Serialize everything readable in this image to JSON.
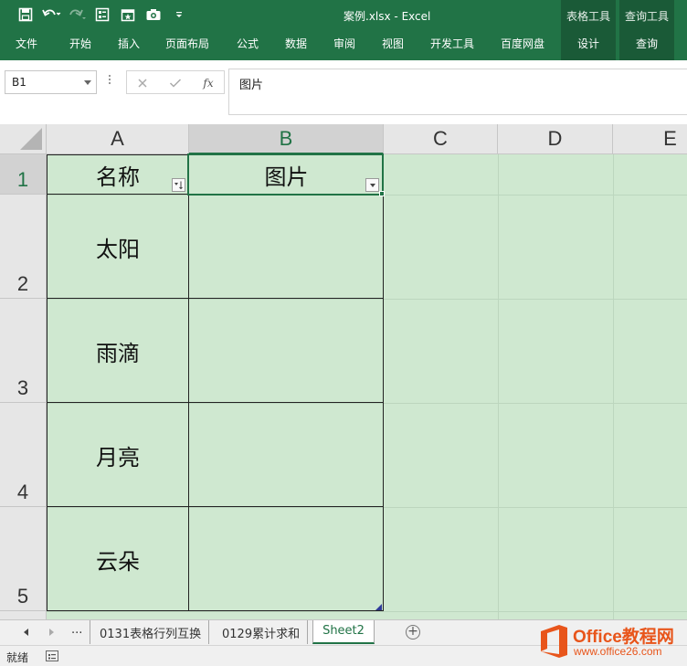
{
  "window": {
    "title": "案例.xlsx - Excel",
    "accent": "#217346"
  },
  "quick_access": [
    {
      "icon": "save-icon"
    },
    {
      "icon": "undo-icon"
    },
    {
      "icon": "redo-icon"
    },
    {
      "icon": "form-icon"
    },
    {
      "icon": "new-sheet-icon"
    },
    {
      "icon": "camera-icon"
    },
    {
      "icon": "customize-qat-icon"
    }
  ],
  "ribbon": {
    "tabs": [
      "文件",
      "开始",
      "插入",
      "页面布局",
      "公式",
      "数据",
      "审阅",
      "视图",
      "开发工具",
      "百度网盘"
    ],
    "context_groups": [
      {
        "label": "表格工具",
        "tab": "设计"
      },
      {
        "label": "查询工具",
        "tab": "查询"
      }
    ]
  },
  "formula_bar": {
    "name_box": "B1",
    "content": "图片"
  },
  "grid": {
    "columns": [
      "A",
      "B",
      "C",
      "D",
      "E"
    ],
    "selected_column": "B",
    "rows": [
      "1",
      "2",
      "3",
      "4",
      "5"
    ],
    "selected_row": "1",
    "fill_color": "#cfe8d0",
    "table": {
      "headers": [
        "名称",
        "图片"
      ],
      "names": [
        "太阳",
        "雨滴",
        "月亮",
        "云朵"
      ]
    }
  },
  "sheet_tabs": {
    "ellipsis": "...",
    "tabs": [
      "0131表格行列互换",
      "0129累计求和",
      "Sheet2"
    ],
    "active": "Sheet2"
  },
  "status": {
    "text": "就绪"
  },
  "watermark": {
    "title": "Office教程网",
    "url": "www.office26.com"
  }
}
